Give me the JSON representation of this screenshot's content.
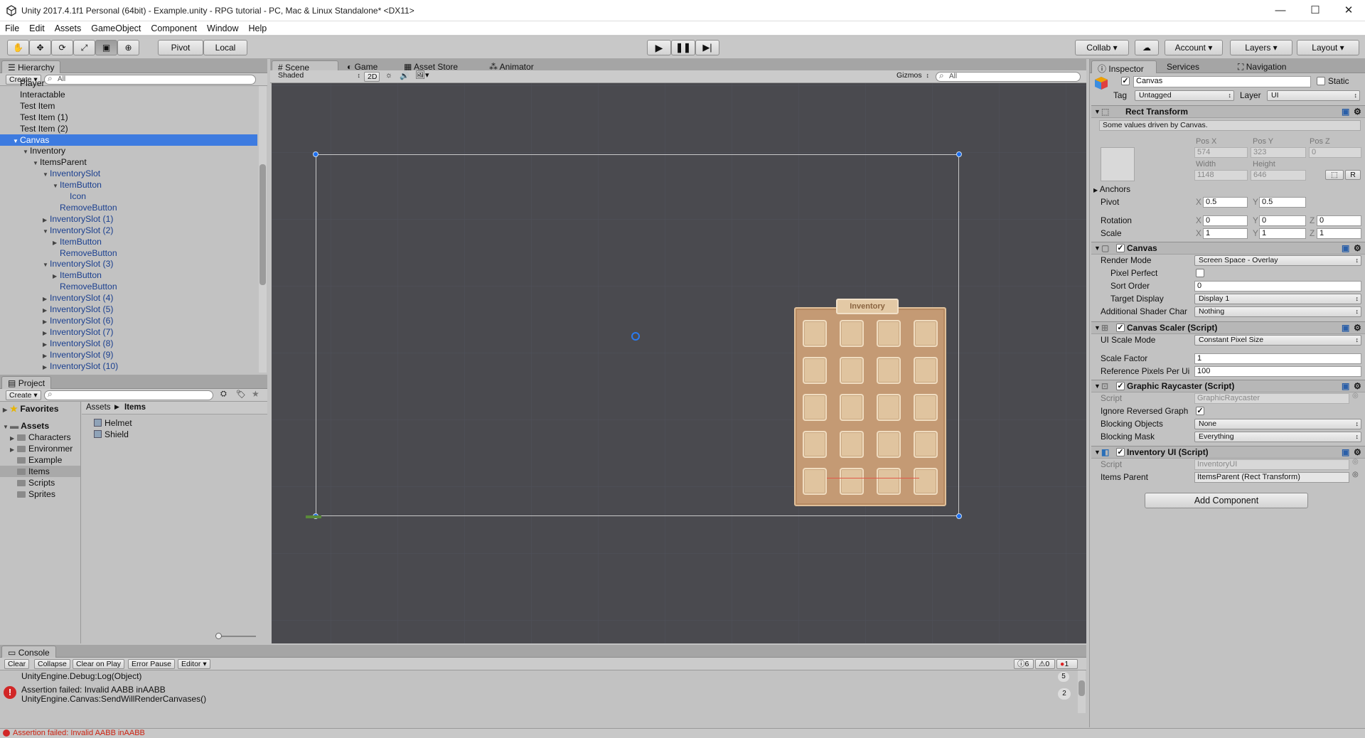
{
  "window": {
    "title": "Unity 2017.4.1f1 Personal (64bit) - Example.unity - RPG tutorial - PC, Mac & Linux Standalone* <DX11>",
    "minimize": "—",
    "maximize": "☐",
    "close": "✕"
  },
  "menu": [
    "File",
    "Edit",
    "Assets",
    "GameObject",
    "Component",
    "Window",
    "Help"
  ],
  "toolbar": {
    "pivot": "Pivot",
    "local": "Local",
    "collab": "Collab ▾",
    "account": "Account",
    "layers": "Layers",
    "layout": "Layout"
  },
  "hierarchy": {
    "tab": "Hierarchy",
    "create": "Create",
    "search_placeholder": "All",
    "rows": [
      {
        "label": "Player",
        "indent": 0,
        "arrow": "",
        "style": "normal"
      },
      {
        "label": "Interactable",
        "indent": 0,
        "arrow": "",
        "style": "normal"
      },
      {
        "label": "Test Item",
        "indent": 0,
        "arrow": "",
        "style": "normal"
      },
      {
        "label": "Test Item (1)",
        "indent": 0,
        "arrow": "",
        "style": "normal"
      },
      {
        "label": "Test Item (2)",
        "indent": 0,
        "arrow": "",
        "style": "normal"
      },
      {
        "label": "Canvas",
        "indent": 0,
        "arrow": "▼",
        "style": "sel"
      },
      {
        "label": "Inventory",
        "indent": 1,
        "arrow": "▼",
        "style": "normal"
      },
      {
        "label": "ItemsParent",
        "indent": 2,
        "arrow": "▼",
        "style": "normal"
      },
      {
        "label": "InventorySlot",
        "indent": 3,
        "arrow": "▼",
        "style": "blue"
      },
      {
        "label": "ItemButton",
        "indent": 4,
        "arrow": "▼",
        "style": "blue"
      },
      {
        "label": "Icon",
        "indent": 5,
        "arrow": "",
        "style": "blue"
      },
      {
        "label": "RemoveButton",
        "indent": 4,
        "arrow": "",
        "style": "blue"
      },
      {
        "label": "InventorySlot (1)",
        "indent": 3,
        "arrow": "▶",
        "style": "blue"
      },
      {
        "label": "InventorySlot (2)",
        "indent": 3,
        "arrow": "▼",
        "style": "blue"
      },
      {
        "label": "ItemButton",
        "indent": 4,
        "arrow": "▶",
        "style": "blue"
      },
      {
        "label": "RemoveButton",
        "indent": 4,
        "arrow": "",
        "style": "blue"
      },
      {
        "label": "InventorySlot (3)",
        "indent": 3,
        "arrow": "▼",
        "style": "blue"
      },
      {
        "label": "ItemButton",
        "indent": 4,
        "arrow": "▶",
        "style": "blue"
      },
      {
        "label": "RemoveButton",
        "indent": 4,
        "arrow": "",
        "style": "blue"
      },
      {
        "label": "InventorySlot (4)",
        "indent": 3,
        "arrow": "▶",
        "style": "blue"
      },
      {
        "label": "InventorySlot (5)",
        "indent": 3,
        "arrow": "▶",
        "style": "blue"
      },
      {
        "label": "InventorySlot (6)",
        "indent": 3,
        "arrow": "▶",
        "style": "blue"
      },
      {
        "label": "InventorySlot (7)",
        "indent": 3,
        "arrow": "▶",
        "style": "blue"
      },
      {
        "label": "InventorySlot (8)",
        "indent": 3,
        "arrow": "▶",
        "style": "blue"
      },
      {
        "label": "InventorySlot (9)",
        "indent": 3,
        "arrow": "▶",
        "style": "blue"
      },
      {
        "label": "InventorySlot (10)",
        "indent": 3,
        "arrow": "▶",
        "style": "blue"
      }
    ]
  },
  "project": {
    "tab": "Project",
    "create": "Create",
    "favorites": "Favorites",
    "assets": "Assets",
    "folders": [
      "Characters",
      "Environmer",
      "Example",
      "Items",
      "Scripts",
      "Sprites"
    ],
    "breadcrumb": [
      "Assets",
      "Items"
    ],
    "items": [
      "Helmet",
      "Shield"
    ]
  },
  "scene": {
    "tabs": [
      "Scene",
      "Game",
      "Asset Store",
      "Animator"
    ],
    "shading": "Shaded",
    "mode2d": "2D",
    "gizmos": "Gizmos",
    "search_placeholder": "All",
    "inventory_title": "Inventory"
  },
  "inspector": {
    "tabs": [
      "Inspector",
      "Services",
      "Navigation"
    ],
    "object_name": "Canvas",
    "static_label": "Static",
    "tag_label": "Tag",
    "tag_value": "Untagged",
    "layer_label": "Layer",
    "layer_value": "UI",
    "rect_transform": {
      "title": "Rect Transform",
      "note": "Some values driven by Canvas.",
      "posx_label": "Pos X",
      "posy_label": "Pos Y",
      "posz_label": "Pos Z",
      "posx": "574",
      "posy": "323",
      "posz": "0",
      "width_label": "Width",
      "height_label": "Height",
      "width": "1148",
      "height": "646",
      "anchors": "Anchors",
      "pivot": "Pivot",
      "pivot_x": "0.5",
      "pivot_y": "0.5",
      "rotation": "Rotation",
      "rot_x": "0",
      "rot_y": "0",
      "rot_z": "0",
      "scale": "Scale",
      "scale_x": "1",
      "scale_y": "1",
      "scale_z": "1",
      "x": "X",
      "y": "Y",
      "z": "Z",
      "r_button": "R"
    },
    "canvas": {
      "title": "Canvas",
      "render_mode_label": "Render Mode",
      "render_mode": "Screen Space - Overlay",
      "pixel_perfect_label": "Pixel Perfect",
      "sort_order_label": "Sort Order",
      "sort_order": "0",
      "target_display_label": "Target Display",
      "target_display": "Display 1",
      "shader_label": "Additional Shader Char",
      "shader_value": "Nothing"
    },
    "scaler": {
      "title": "Canvas Scaler (Script)",
      "ui_scale_label": "UI Scale Mode",
      "ui_scale": "Constant Pixel Size",
      "scale_factor_label": "Scale Factor",
      "scale_factor": "1",
      "ref_pixels_label": "Reference Pixels Per Ui",
      "ref_pixels": "100"
    },
    "raycaster": {
      "title": "Graphic Raycaster (Script)",
      "script_label": "Script",
      "script": "GraphicRaycaster",
      "ignore_label": "Ignore Reversed Graph",
      "blocking_objects_label": "Blocking Objects",
      "blocking_objects": "None",
      "blocking_mask_label": "Blocking Mask",
      "blocking_mask": "Everything"
    },
    "inventory_ui": {
      "title": "Inventory UI (Script)",
      "script_label": "Script",
      "script": "InventoryUI",
      "items_parent_label": "Items Parent",
      "items_parent": "ItemsParent (Rect Transform)"
    },
    "add_component": "Add Component"
  },
  "console": {
    "tab": "Console",
    "buttons": [
      "Clear",
      "Collapse",
      "Clear on Play",
      "Error Pause",
      "Editor"
    ],
    "counts": {
      "info": "6",
      "warn": "0",
      "error": "1"
    },
    "line0": "UnityEngine.Debug:Log(Object)",
    "line0_count": "5",
    "err1": "Assertion failed: Invalid AABB inAABB",
    "err2": "UnityEngine.Canvas:SendWillRenderCanvases()",
    "err_count": "2",
    "status": "Assertion failed: Invalid AABB inAABB"
  },
  "colors": {
    "selection": "#3d7be0",
    "prefab_text": "#1a3f8f",
    "scene_bg": "#4a4a4f",
    "handle": "#1c6ef0",
    "panel_tan": "#c49a74"
  }
}
